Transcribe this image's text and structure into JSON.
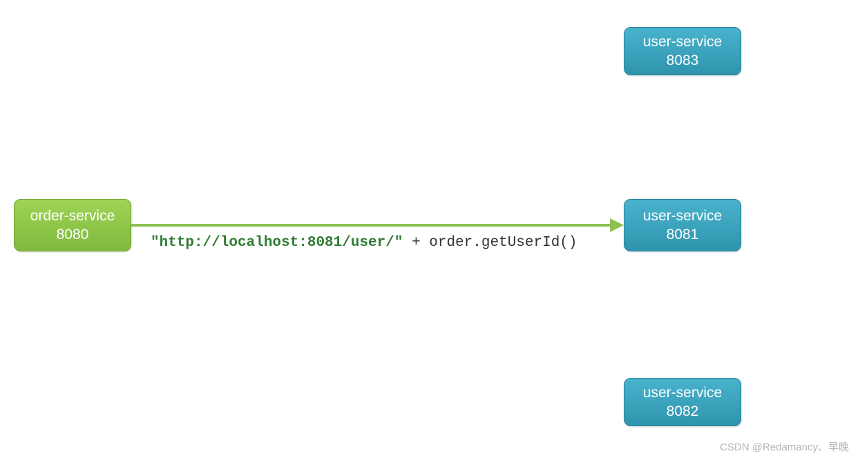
{
  "nodes": {
    "order_service": {
      "name": "order-service",
      "port": "8080"
    },
    "user_8083": {
      "name": "user-service",
      "port": "8083"
    },
    "user_8081": {
      "name": "user-service",
      "port": "8081"
    },
    "user_8082": {
      "name": "user-service",
      "port": "8082"
    }
  },
  "arrow": {
    "url_string": "\"http://localhost:8081/user/\"",
    "concat": " + order.getUserId()"
  },
  "watermark": "CSDN @Redamancy、早晚"
}
